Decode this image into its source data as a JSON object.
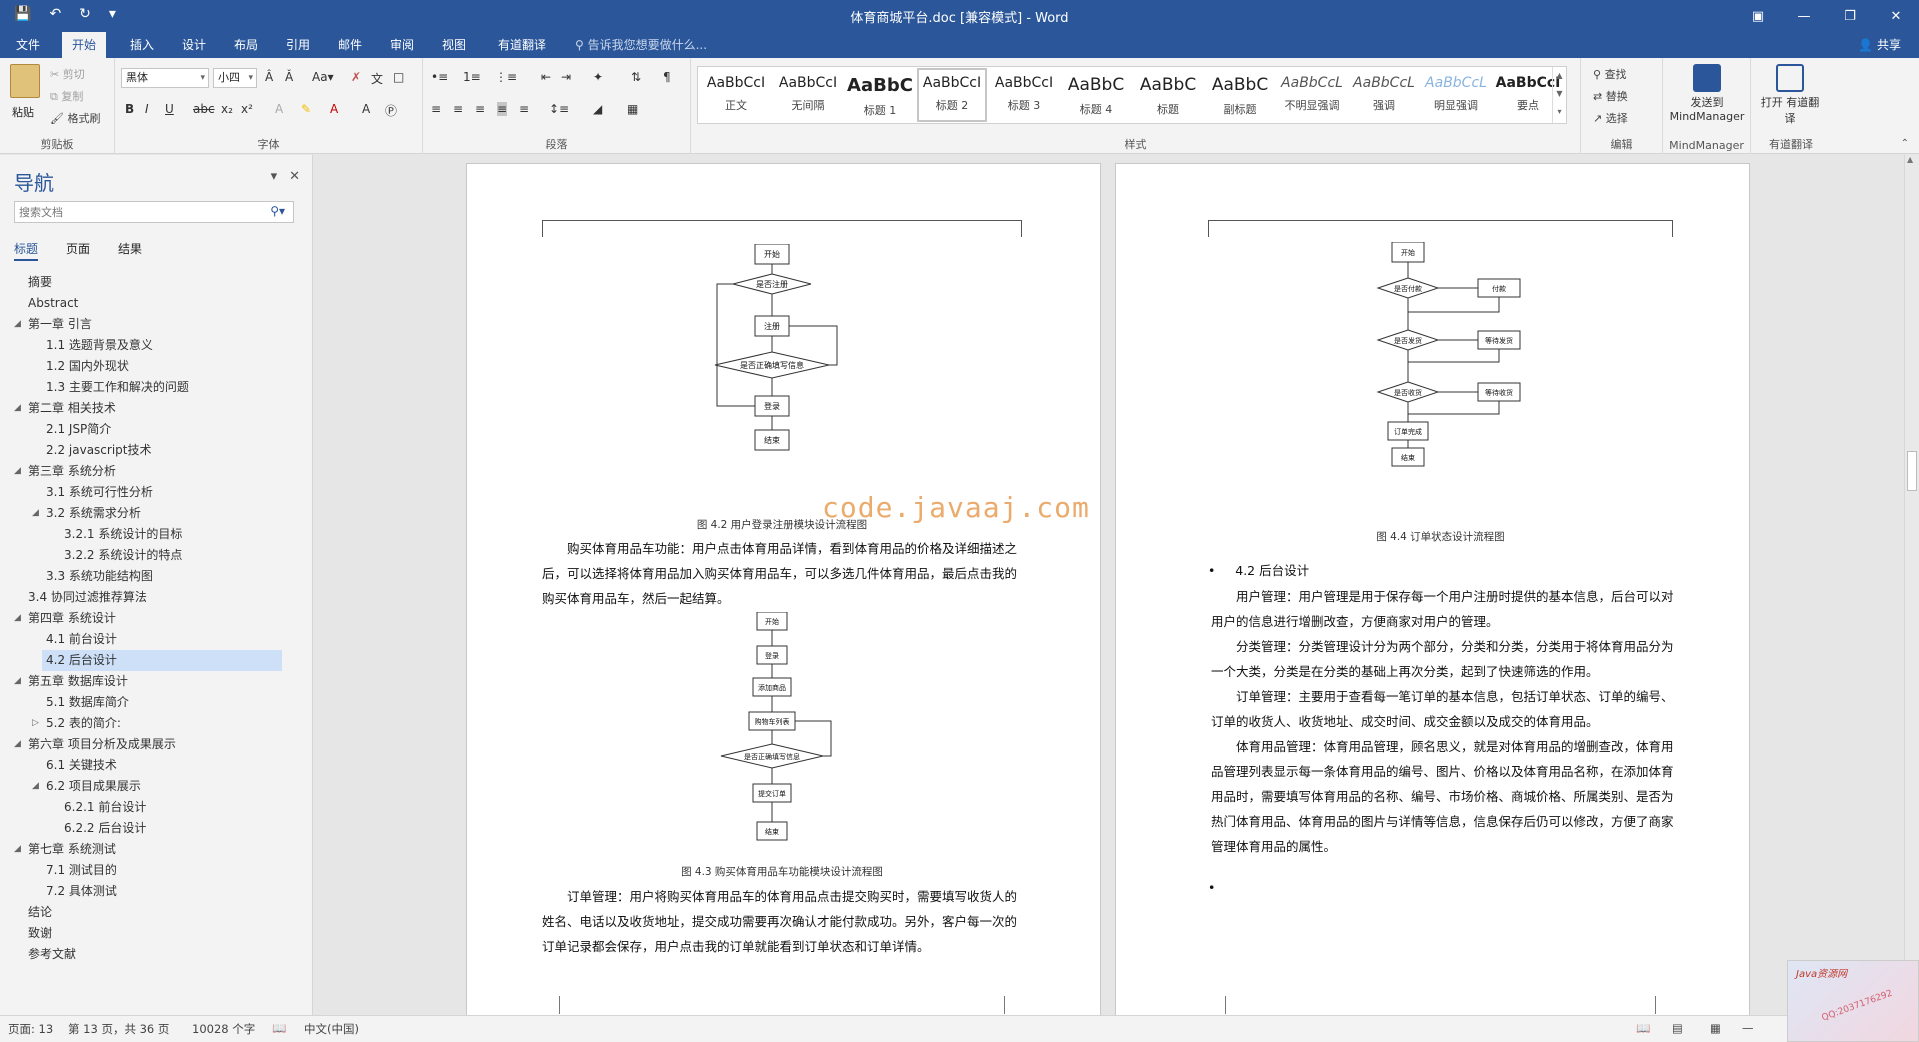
{
  "window": {
    "title": "体育商城平台.doc [兼容模式] - Word"
  },
  "tabs": [
    "文件",
    "开始",
    "插入",
    "设计",
    "布局",
    "引用",
    "邮件",
    "审阅",
    "视图",
    "有道翻译"
  ],
  "active_tab": "开始",
  "tell_me": "告诉我您想要做什么...",
  "share": "共享",
  "ribbon": {
    "clipboard": {
      "paste": "粘贴",
      "cut": "剪切",
      "copy": "复制",
      "format_painter": "格式刷",
      "label": "剪贴板"
    },
    "font": {
      "name": "黑体",
      "size": "小四",
      "label": "字体"
    },
    "paragraph": {
      "label": "段落"
    },
    "styles": {
      "label": "样式",
      "items": [
        {
          "sample": "AaBbCcI",
          "name": "正文"
        },
        {
          "sample": "AaBbCcI",
          "name": "无间隔"
        },
        {
          "sample": "AaBbC",
          "name": "标题 1"
        },
        {
          "sample": "AaBbCcI",
          "name": "标题 2"
        },
        {
          "sample": "AaBbCcI",
          "name": "标题 3"
        },
        {
          "sample": "AaBbC",
          "name": "标题 4"
        },
        {
          "sample": "AaBbC",
          "name": "标题"
        },
        {
          "sample": "AaBbC",
          "name": "副标题"
        },
        {
          "sample": "AaBbCcL",
          "name": "不明显强调"
        },
        {
          "sample": "AaBbCcL",
          "name": "强调"
        },
        {
          "sample": "AaBbCcL",
          "name": "明显强调"
        },
        {
          "sample": "AaBbCcI",
          "name": "要点"
        }
      ]
    },
    "editing": {
      "find": "查找",
      "replace": "替换",
      "select": "选择",
      "label": "编辑"
    },
    "mindmanager": {
      "btn": "发送到 MindManager",
      "label": "MindManager"
    },
    "youdao": {
      "btn": "打开 有道翻译",
      "label": "有道翻译"
    }
  },
  "nav": {
    "title": "导航",
    "search_placeholder": "搜索文档",
    "tabs": [
      "标题",
      "页面",
      "结果"
    ],
    "items": [
      {
        "text": "摘要",
        "level": 0
      },
      {
        "text": "Abstract",
        "level": 0
      },
      {
        "text": "第一章 引言",
        "level": 0,
        "expanded": true
      },
      {
        "text": "1.1 选题背景及意义",
        "level": 1
      },
      {
        "text": "1.2 国内外现状",
        "level": 1
      },
      {
        "text": "1.3 主要工作和解决的问题",
        "level": 1
      },
      {
        "text": "第二章 相关技术",
        "level": 0,
        "expanded": true
      },
      {
        "text": "2.1 JSP简介",
        "level": 1
      },
      {
        "text": "2.2 javascript技术",
        "level": 1
      },
      {
        "text": "第三章 系统分析",
        "level": 0,
        "expanded": true
      },
      {
        "text": "3.1 系统可行性分析",
        "level": 1
      },
      {
        "text": "3.2 系统需求分析",
        "level": 1,
        "expanded": true
      },
      {
        "text": "3.2.1 系统设计的目标",
        "level": 2
      },
      {
        "text": "3.2.2 系统设计的特点",
        "level": 2
      },
      {
        "text": "3.3 系统功能结构图",
        "level": 1
      },
      {
        "text": "3.4 协同过滤推荐算法",
        "level": 0
      },
      {
        "text": "第四章 系统设计",
        "level": 0,
        "expanded": true
      },
      {
        "text": "4.1 前台设计",
        "level": 1
      },
      {
        "text": "4.2 后台设计",
        "level": 1,
        "selected": true
      },
      {
        "text": "第五章 数据库设计",
        "level": 0,
        "expanded": true
      },
      {
        "text": "5.1 数据库简介",
        "level": 1
      },
      {
        "text": "5.2 表的简介:",
        "level": 1,
        "collapsed": true
      },
      {
        "text": "第六章 项目分析及成果展示",
        "level": 0,
        "expanded": true
      },
      {
        "text": "6.1 关键技术",
        "level": 1
      },
      {
        "text": "6.2 项目成果展示",
        "level": 1,
        "expanded": true
      },
      {
        "text": "6.2.1 前台设计",
        "level": 2
      },
      {
        "text": "6.2.2 后台设计",
        "level": 2
      },
      {
        "text": "第七章 系统测试",
        "level": 0,
        "expanded": true
      },
      {
        "text": "7.1 测试目的",
        "level": 1
      },
      {
        "text": "7.2 具体测试",
        "level": 1
      },
      {
        "text": "结论",
        "level": 0
      },
      {
        "text": "致谢",
        "level": 0
      },
      {
        "text": "参考文献",
        "level": 0
      }
    ]
  },
  "page_left": {
    "fig42": {
      "nodes": [
        "开始",
        "是否注册",
        "注册",
        "是否正确填写信息",
        "登录",
        "结束"
      ],
      "caption": "图 4.2  用户登录注册模块设计流程图"
    },
    "para1": "购买体育用品车功能：用户点击体育用品详情，看到体育用品的价格及详细描述之后，可以选择将体育用品加入购买体育用品车，可以多选几件体育用品，最后点击我的购买体育用品车，然后一起结算。",
    "fig43": {
      "nodes": [
        "开始",
        "登录",
        "添加商品",
        "购物车列表",
        "是否正确填写信息",
        "提交订单",
        "结束"
      ],
      "caption": "图 4.3  购买体育用品车功能模块设计流程图"
    },
    "para2": "订单管理：用户将购买体育用品车的体育用品点击提交购买时，需要填写收货人的姓名、电话以及收货地址，提交成功需要再次确认才能付款成功。另外，客户每一次的订单记录都会保存，用户点击我的订单就能看到订单状态和订单详情。"
  },
  "page_right": {
    "fig44": {
      "nodes": [
        "开始",
        "是否付款",
        "付款",
        "是否发货",
        "等待发货",
        "是否收货",
        "等待收货",
        "订单完成",
        "结束"
      ],
      "caption": "图 4.4  订单状态设计流程图"
    },
    "heading": "4.2  后台设计",
    "p1": "用户管理：用户管理是用于保存每一个用户注册时提供的基本信息，后台可以对用户的信息进行增删改查，方便商家对用户的管理。",
    "p2": "分类管理：分类管理设计分为两个部分，分类和分类，分类用于将体育用品分为一个大类，分类是在分类的基础上再次分类，起到了快速筛选的作用。",
    "p3": "订单管理：主要用于查看每一笔订单的基本信息，包括订单状态、订单的编号、订单的收货人、收货地址、成交时间、成交金额以及成交的体育用品。",
    "p4": "体育用品管理：体育用品管理，顾名思义，就是对体育用品的增删查改，体育用品管理列表显示每一条体育用品的编号、图片、价格以及体育用品名称，在添加体育用品时，需要填写体育用品的名称、编号、市场价格、商城价格、所属类别、是否为热门体育用品、体育用品的图片与详情等信息，信息保存后仍可以修改，方便了商家管理体育用品的属性。"
  },
  "watermark": "code.javaaj.com",
  "status": {
    "page": "页面: 13",
    "pages": "第 13 页，共 36 页",
    "words": "10028 个字",
    "language": "中文(中国)"
  },
  "thumbnail": {
    "t1": "Java资源网",
    "t2": "QQ:2037176292"
  }
}
